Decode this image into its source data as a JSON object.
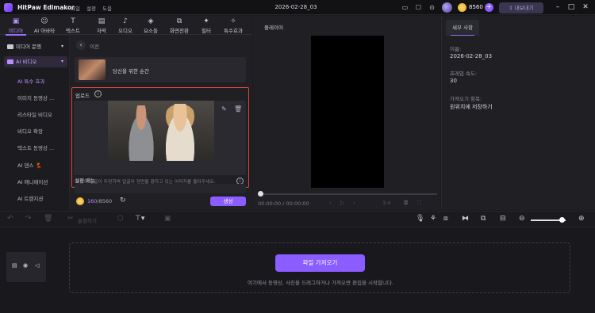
{
  "app": {
    "name": "HitPaw Edimakor",
    "menu": [
      "파일",
      "설정",
      "도움"
    ],
    "project_title": "2026-02-28_03",
    "credits": "8560",
    "export_label": "내보내기"
  },
  "tool_tabs": [
    {
      "label": "미디어",
      "icon": "media-icon"
    },
    {
      "label": "AI 아바타",
      "icon": "ai-avatar-icon"
    },
    {
      "label": "텍스트",
      "icon": "text-icon"
    },
    {
      "label": "자막",
      "icon": "subtitle-icon"
    },
    {
      "label": "오디오",
      "icon": "audio-icon"
    },
    {
      "label": "요소들",
      "icon": "elements-icon"
    },
    {
      "label": "화면전환",
      "icon": "transition-icon"
    },
    {
      "label": "필터",
      "icon": "filter-icon"
    },
    {
      "label": "특수효과",
      "icon": "effects-icon"
    }
  ],
  "sidebar": {
    "sections": [
      {
        "label": "미디어 문행"
      },
      {
        "label": "AI 비디오"
      }
    ],
    "items": [
      {
        "label": "AI 특수 효과"
      },
      {
        "label": "이미지 동영상 ..."
      },
      {
        "label": "리스타일 비디오"
      },
      {
        "label": "비디오 확장"
      },
      {
        "label": "텍스트 동영상 ..."
      },
      {
        "label": "AI 댄스 💃"
      },
      {
        "label": "AI 애니메이션"
      },
      {
        "label": "AI 트랜지션"
      }
    ]
  },
  "content": {
    "back_label": "이전",
    "template_title": "당신을 위한 순간",
    "upload_label": "업로드",
    "hint": "사람의 얼굴이 뚜렷하며 얼굴이 정면을 향하고 있는 이미지를 올려주세요.",
    "settings_label": "설정 메뉴",
    "cost_used": "160",
    "cost_total": "/8560",
    "generate_label": "생성"
  },
  "player": {
    "label": "플레이어",
    "time": "00:00:00 / 00:00:00",
    "aspect": "3:4"
  },
  "properties": {
    "tab_label": "세부 사항",
    "name_label": "이름:",
    "name_value": "2026-02-28_03",
    "fps_label": "프레임 속도:",
    "fps_value": "30",
    "path_label": "가져오기 항목:",
    "path_value": "원위치에 저장하기"
  },
  "timeline": {
    "split_label": "분할하기",
    "import_label": "파일 가져오기",
    "drop_hint": "여기에서 동영상, 사진을 드래그하거나 가져오면 편집을 시작합니다."
  }
}
